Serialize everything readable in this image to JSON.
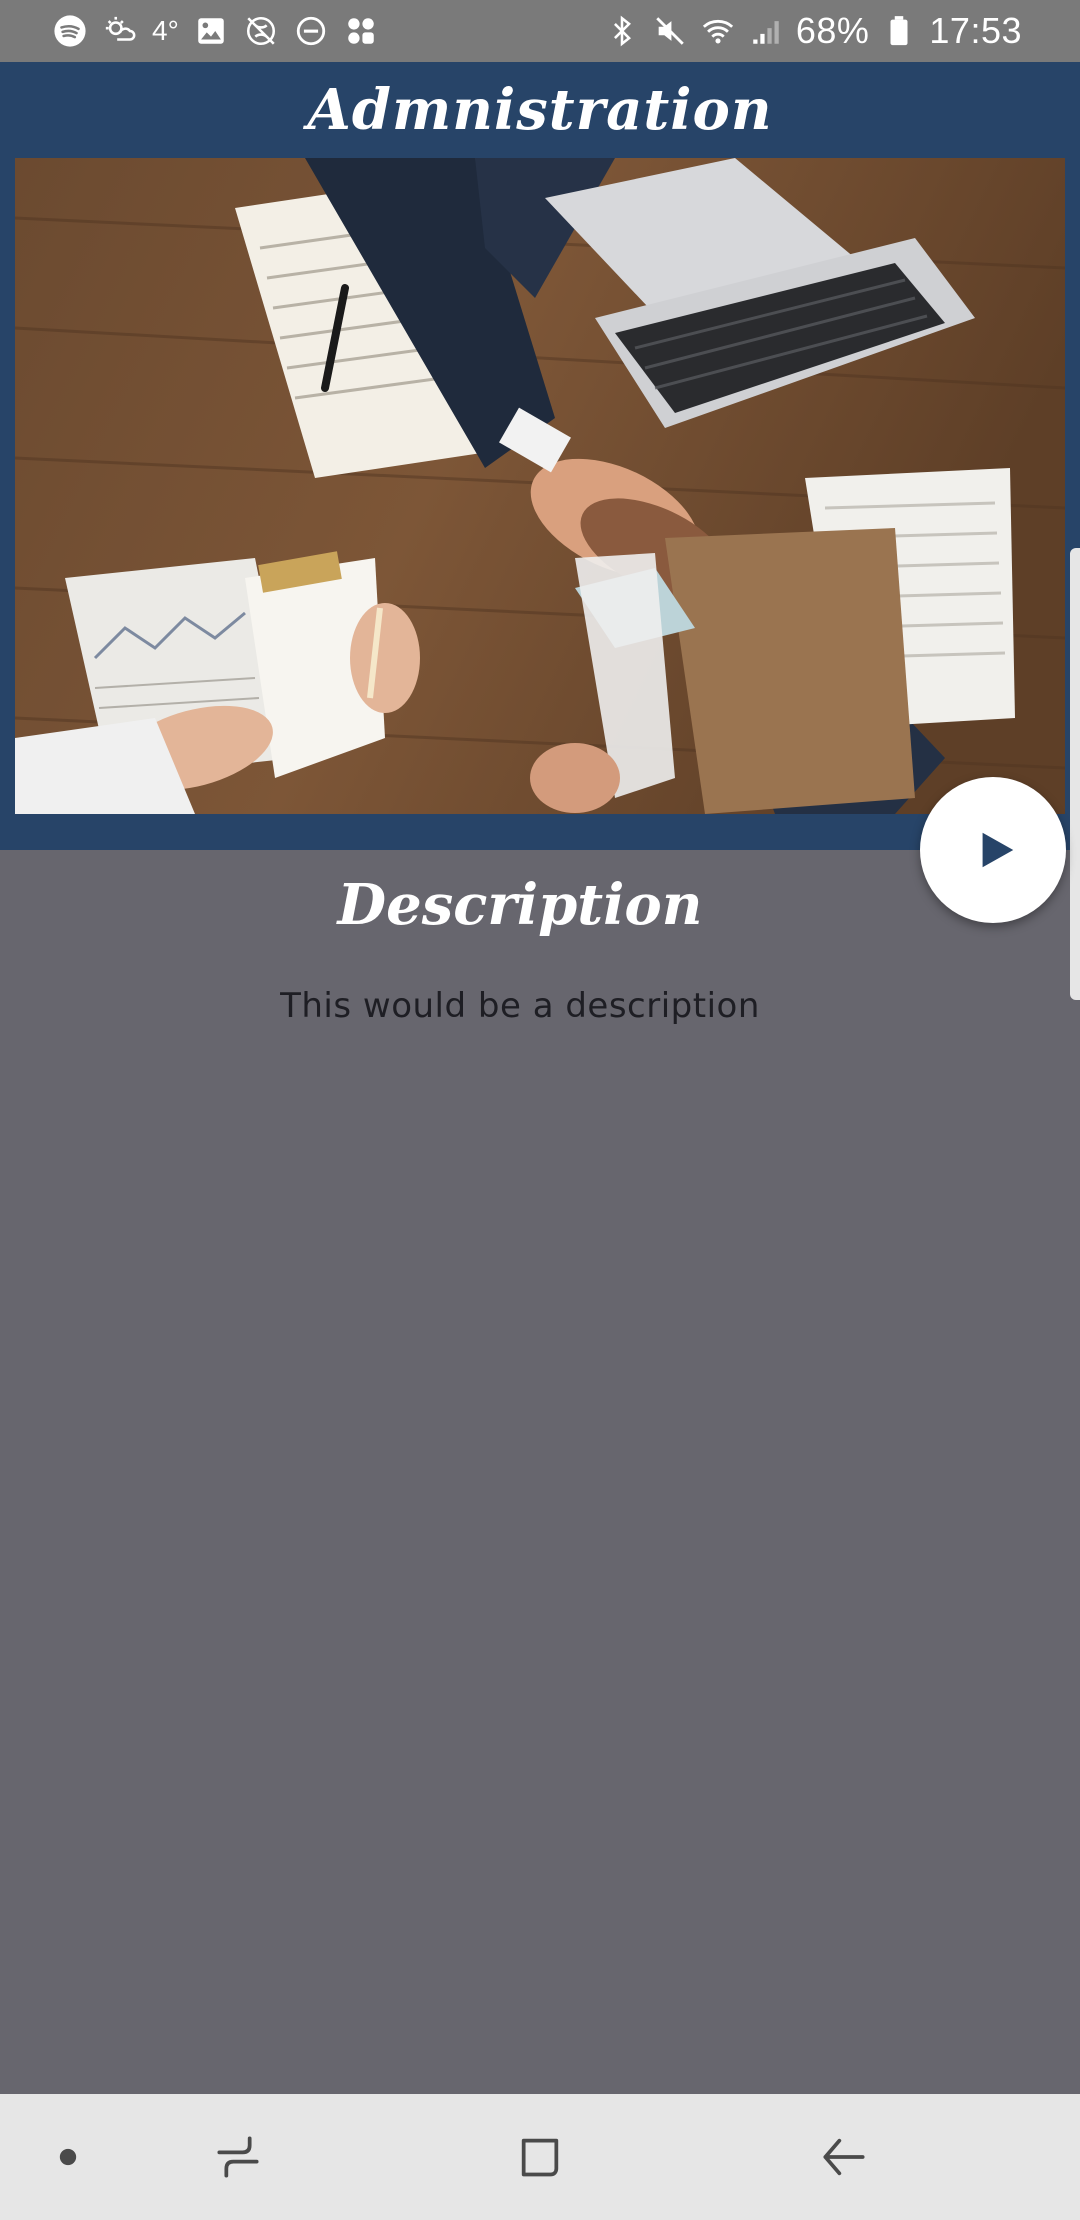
{
  "status_bar": {
    "left_icons": [
      "spotify-icon",
      "weather-icon",
      "image-icon",
      "no-location-icon",
      "do-not-disturb-icon",
      "app-shortcut-icon"
    ],
    "temperature": "4°",
    "battery_percent": "68%",
    "time": "17:53",
    "right_icons": [
      "bluetooth-icon",
      "mute-icon",
      "wifi-icon",
      "signal-icon",
      "battery-icon"
    ]
  },
  "header": {
    "title": "Admnistration",
    "background_color": "#274468"
  },
  "hero": {
    "image_description_icon": "business-handshake-photo"
  },
  "play_button": {
    "icon": "play-icon",
    "icon_color": "#274468"
  },
  "content": {
    "section_heading": "Description",
    "description": "This would be a description",
    "background_color": "#67666e"
  },
  "nav_bar": {
    "buttons": [
      "dot-icon",
      "recent-apps-icon",
      "home-icon",
      "back-icon"
    ]
  }
}
